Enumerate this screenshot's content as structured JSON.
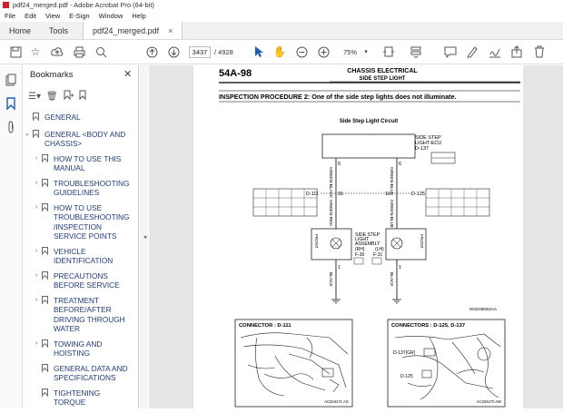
{
  "window": {
    "title": "pdf24_merged.pdf - Adobe Acrobat Pro (64-bit)"
  },
  "menu": [
    "File",
    "Edit",
    "View",
    "E-Sign",
    "Window",
    "Help"
  ],
  "tabs": {
    "home": "Home",
    "tools": "Tools",
    "doc": "pdf24_merged.pdf",
    "close": "×"
  },
  "toolbar": {
    "page_current": "3437",
    "page_total": "/  4928",
    "zoom": "75%"
  },
  "bookmarks": {
    "title": "Bookmarks",
    "items": [
      {
        "label": "GENERAL",
        "expandable": false
      },
      {
        "label": "GENERAL <BODY AND CHASSIS>",
        "expandable": true,
        "expanded": true
      },
      {
        "label": "HOW TO USE THIS MANUAL",
        "expandable": true
      },
      {
        "label": "TROUBLESHOOTING GUIDELINES",
        "expandable": true
      },
      {
        "label": "HOW TO USE TROUBLESHOOTING /INSPECTION SERVICE POINTS",
        "expandable": true
      },
      {
        "label": "VEHICLE IDENTIFICATION",
        "expandable": true
      },
      {
        "label": "PRECAUTIONS BEFORE SERVICE",
        "expandable": true
      },
      {
        "label": "TREATMENT BEFORE/AFTER DRIVING THROUGH WATER",
        "expandable": true
      },
      {
        "label": "TOWING AND HOISTING",
        "expandable": true
      },
      {
        "label": "GENERAL DATA AND SPECIFICATIONS",
        "expandable": false
      },
      {
        "label": "TIGHTENING TORQUE",
        "expandable": false
      }
    ]
  },
  "document": {
    "page_number": "54A-98",
    "section": "CHASSIS ELECTRICAL",
    "subsection": "SIDE STEP LIGHT",
    "procedure": "INSPECTION PROCEDURE 2: One of the side step lights does not illuminate.",
    "circuit_title": "Side Step Light Circuit",
    "ecu_label_1": "SIDE STEP",
    "ecu_label_2": "LIGHT-ECU",
    "ecu_connector": "D-137",
    "pin_left_top": "5",
    "pin_right_top": "6",
    "wire_left": "GREEN-BLACK",
    "wire_right": "GREEN-BLUE",
    "conn_left": "D-111",
    "conn_left_pin": "31",
    "conn_right_pin": "16",
    "conn_right": "D-125",
    "wire_left_lower": "GREEN-RED",
    "wire_right_lower": "GREEN-BLUE",
    "front_left": "FRONT",
    "front_right": "FRONT",
    "assembly_1": "SIDE STEP",
    "assembly_2": "LIGHT",
    "assembly_3": "ASSEMBLY",
    "rh": "(RH)",
    "lh": "(LH)",
    "f30": "F-30",
    "f31": "F-31",
    "pin_left_bottom": "1",
    "pin_right_bottom": "1",
    "ground_left": "BLACK",
    "ground_right": "BLACK",
    "diagram_code": "W3G09M02AA",
    "connector_box_1": "CONNECTOR : D-111",
    "connector_box_2": "CONNECTORS : D-125, D-137",
    "photo1_code": "AC204171 AG",
    "photo2_code": "AC204170 AW",
    "photo2_d137": "D-137(GR)",
    "photo2_d125": "D-125"
  }
}
